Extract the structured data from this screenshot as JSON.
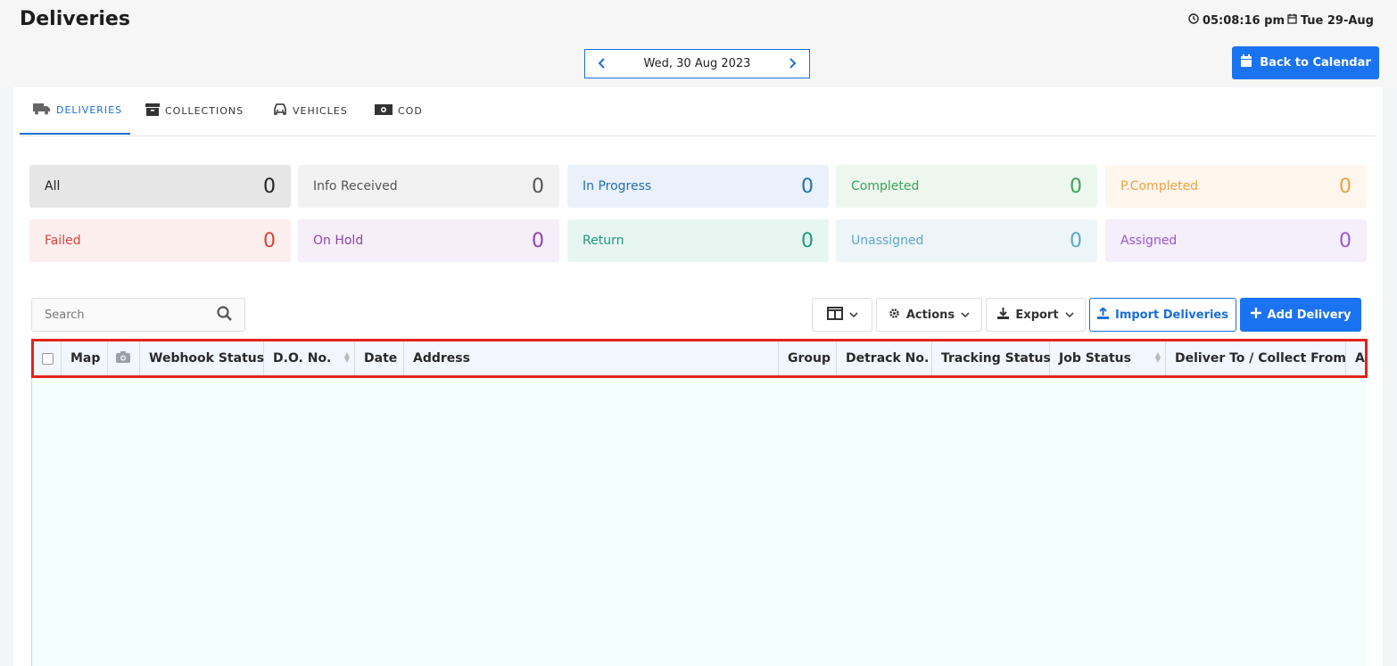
{
  "header": {
    "title": "Deliveries",
    "time": "05:08:16 pm",
    "date": "Tue 29-Aug",
    "clock_icon": "clock-icon",
    "calendar_icon": "calendar-icon"
  },
  "date_nav": {
    "date": "Wed, 30 Aug 2023",
    "prev": "‹",
    "next": "›"
  },
  "back_button": {
    "label": "Back to Calendar"
  },
  "tabs": [
    {
      "label": "DELIVERIES",
      "icon": "truck-icon",
      "active": true
    },
    {
      "label": "COLLECTIONS",
      "icon": "archive-icon",
      "active": false
    },
    {
      "label": "VEHICLES",
      "icon": "car-icon",
      "active": false
    },
    {
      "label": "COD",
      "icon": "money-icon",
      "active": false
    }
  ],
  "status_tiles": [
    {
      "label": "All",
      "count": "0",
      "color": "#222222",
      "bg": "#e6e6e6"
    },
    {
      "label": "Info Received",
      "count": "0",
      "color": "#555555",
      "bg": "#f2f2f2"
    },
    {
      "label": "In Progress",
      "count": "0",
      "color": "#1f6fb5",
      "bg": "#eaf1fb"
    },
    {
      "label": "Completed",
      "count": "0",
      "color": "#3aa35a",
      "bg": "#edf7ee"
    },
    {
      "label": "P.Completed",
      "count": "0",
      "color": "#f0a040",
      "bg": "#fff6ee"
    },
    {
      "label": "Failed",
      "count": "0",
      "color": "#d9443a",
      "bg": "#fdeeee"
    },
    {
      "label": "On Hold",
      "count": "0",
      "color": "#8e44ad",
      "bg": "#f6eef9"
    },
    {
      "label": "Return",
      "count": "0",
      "color": "#1a9a7a",
      "bg": "#e8f6f2"
    },
    {
      "label": "Unassigned",
      "count": "0",
      "color": "#5aa9c8",
      "bg": "#eef5f8"
    },
    {
      "label": "Assigned",
      "count": "0",
      "color": "#9b59d0",
      "bg": "#f5eefb"
    }
  ],
  "search": {
    "placeholder": "Search"
  },
  "toolbar": {
    "actions_label": "Actions",
    "export_label": "Export",
    "import_label": "Import Deliveries",
    "add_label": "Add Delivery"
  },
  "table": {
    "columns": [
      "Map",
      "Webhook Status",
      "D.O. No.",
      "Date",
      "Address",
      "Group",
      "Detrack No.",
      "Tracking Status",
      "Job Status",
      "Deliver To / Collect From",
      "A"
    ]
  },
  "colors": {
    "accent": "#1a73f0",
    "highlight_border": "#e2231a"
  }
}
